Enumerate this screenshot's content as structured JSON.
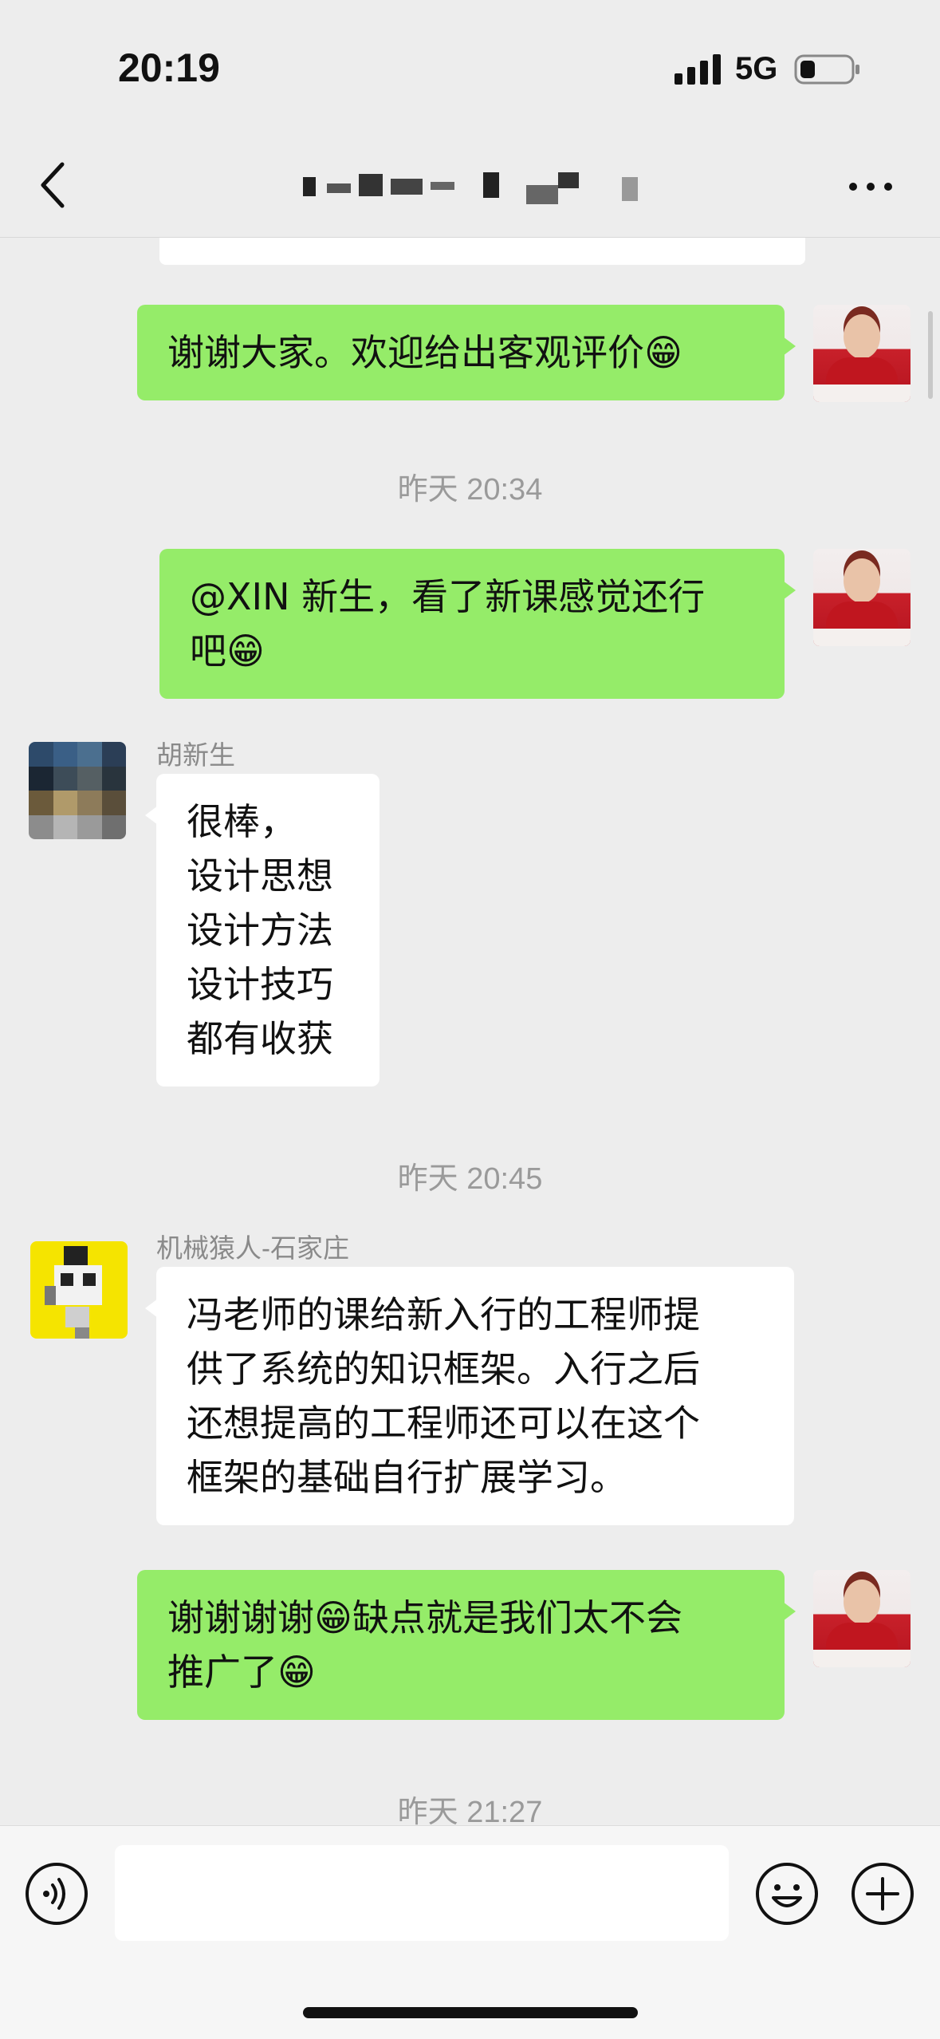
{
  "status_bar": {
    "time": "20:19",
    "network": "5G"
  },
  "nav": {
    "back_icon": "chevron-left-icon",
    "more_icon": "ellipsis-icon"
  },
  "messages": {
    "m1": {
      "side": "right",
      "text": "谢谢大家。欢迎给出客观评价😁"
    },
    "t1": "昨天 20:34",
    "m2": {
      "side": "right",
      "text": "@XIN 新生，看了新课感觉还行\n吧😁"
    },
    "m3": {
      "side": "left",
      "sender": "胡新生",
      "text": "很棒，\n设计思想\n设计方法\n设计技巧\n都有收获"
    },
    "t2": "昨天 20:45",
    "m4": {
      "side": "left",
      "sender": "机械猿人-石家庄",
      "text": "冯老师的课给新入行的工程师提\n供了系统的知识框架。入行之后\n还想提高的工程师还可以在这个\n框架的基础自行扩展学习。"
    },
    "m5": {
      "side": "right",
      "text": "谢谢谢谢😁缺点就是我们太不会\n推广了😁"
    },
    "t3": "昨天 21:27"
  },
  "input_bar": {
    "voice_icon": "voice-icon",
    "emoji_icon": "emoji-icon",
    "plus_icon": "plus-icon",
    "text_value": ""
  },
  "colors": {
    "background": "#ededed",
    "bubble_self": "#95ec69",
    "bubble_other": "#ffffff",
    "timestamp": "#9a9a9a"
  }
}
